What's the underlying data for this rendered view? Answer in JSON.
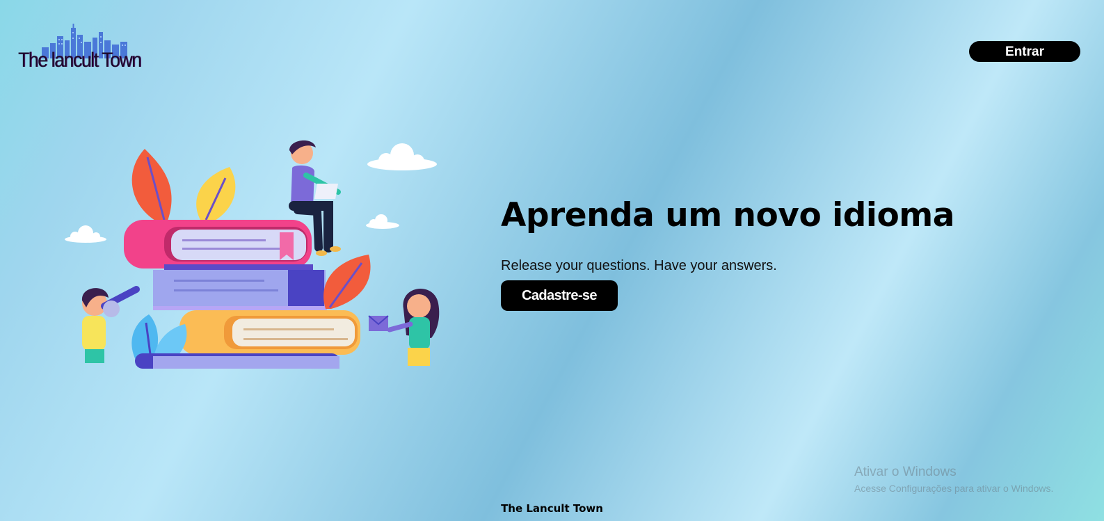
{
  "header": {
    "logo_text": "The lancult Town",
    "login_label": "Entrar"
  },
  "hero": {
    "title": "Aprenda um novo idioma",
    "subtitle": "Release your questions. Have your answers.",
    "signup_label": "Cadastre-se"
  },
  "windows_activation": {
    "title": "Ativar o Windows",
    "subtitle": "Acesse Configurações para ativar o Windows."
  },
  "footer": {
    "text": "The Lancult Town"
  },
  "colors": {
    "button_bg": "#000000",
    "button_text": "#ffffff",
    "logo_buildings": "#4a78d8"
  }
}
